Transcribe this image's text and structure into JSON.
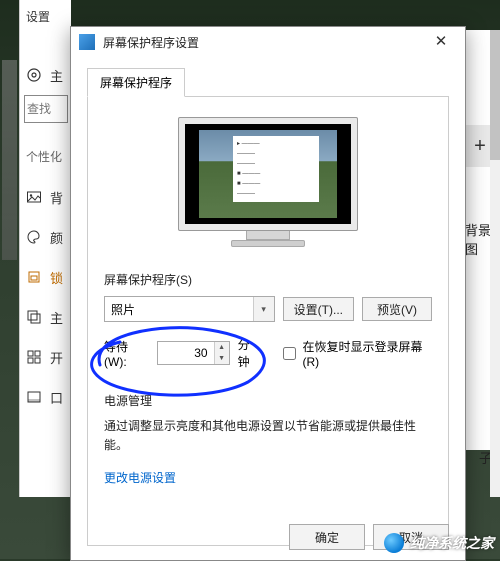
{
  "settings": {
    "window_title": "设置",
    "home_label": "主",
    "search_placeholder": "查找",
    "category": "个性化",
    "items": [
      "背",
      "颜",
      "锁",
      "主",
      "开",
      "口"
    ]
  },
  "right": {
    "plus": "+",
    "text1": "背景图",
    "text2": "子"
  },
  "dialog": {
    "title": "屏幕保护程序设置",
    "tab_label": "屏幕保护程序",
    "group_label": "屏幕保护程序(S)",
    "combo_value": "照片",
    "settings_btn": "设置(T)...",
    "preview_btn": "预览(V)",
    "wait_label": "等待(W):",
    "wait_value": "30",
    "wait_unit": "分钟",
    "resume_label": "在恢复时显示登录屏幕(R)",
    "pm_heading": "电源管理",
    "pm_desc": "通过调整显示亮度和其他电源设置以节省能源或提供最佳性能。",
    "pm_link": "更改电源设置",
    "ok": "确定",
    "cancel": "取消"
  },
  "watermark": {
    "text": "纯净系统之家"
  }
}
